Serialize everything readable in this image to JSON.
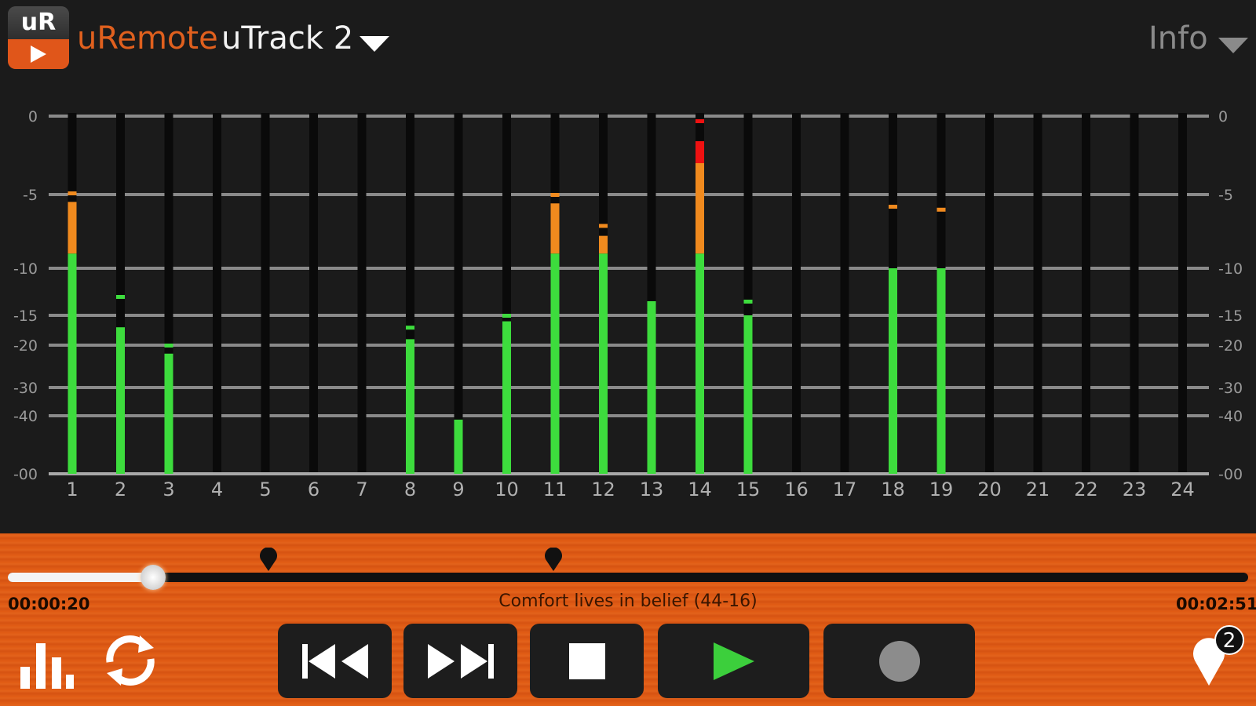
{
  "header": {
    "logo_text": "uR",
    "app_name": "uRemote",
    "device_name": "uTrack 2",
    "info_label": "Info"
  },
  "meters": {
    "scale_labels": [
      "0",
      "-5",
      "-10",
      "-15",
      "-20",
      "-30",
      "-40",
      "-00"
    ],
    "colors": {
      "green": "#3ddc3d",
      "orange": "#f08a1e",
      "red": "#ee1111",
      "grid": "#8a8a8a",
      "track": "#0a0a0a"
    },
    "channels": [
      {
        "label": "1",
        "level": -9,
        "peak": -4.9,
        "orange_from": -5.5
      },
      {
        "label": "2",
        "level": -17,
        "peak": -13
      },
      {
        "label": "3",
        "level": -22,
        "peak": -20
      },
      {
        "label": "4",
        "level": null
      },
      {
        "label": "5",
        "level": null
      },
      {
        "label": "6",
        "level": null
      },
      {
        "label": "7",
        "level": null
      },
      {
        "label": "8",
        "level": -19,
        "peak": -17
      },
      {
        "label": "9",
        "level": -44
      },
      {
        "label": "10",
        "level": -16,
        "peak": -15
      },
      {
        "label": "11",
        "level": -9,
        "peak": -5,
        "orange_from": -5.6
      },
      {
        "label": "12",
        "level": -9,
        "peak": -7.1,
        "orange_from": -7.8
      },
      {
        "label": "13",
        "level": -13.5
      },
      {
        "label": "14",
        "level": -9,
        "peak": -0.3,
        "orange_from": -3,
        "red_from": -1.6
      },
      {
        "label": "15",
        "level": -15,
        "peak": -13.5
      },
      {
        "label": "16",
        "level": null
      },
      {
        "label": "17",
        "level": null
      },
      {
        "label": "18",
        "level": -10,
        "peak": -5.8
      },
      {
        "label": "19",
        "level": -10,
        "peak": -6
      },
      {
        "label": "20",
        "level": null
      },
      {
        "label": "21",
        "level": null
      },
      {
        "label": "22",
        "level": null
      },
      {
        "label": "23",
        "level": null
      },
      {
        "label": "24",
        "level": null
      }
    ]
  },
  "transport": {
    "time_elapsed": "00:00:20",
    "time_total": "00:02:51",
    "song_title": "Comfort lives in belief (44-16)",
    "progress": 0.117,
    "marker_positions": [
      0.21,
      0.44
    ],
    "marker_count": "2",
    "buttons": {
      "prev": "skip-back-icon",
      "next": "skip-forward-icon",
      "stop": "stop-icon",
      "play": "play-icon",
      "record": "record-icon"
    },
    "play_color": "#3ccf3c",
    "record_color": "#8c8c8c"
  }
}
